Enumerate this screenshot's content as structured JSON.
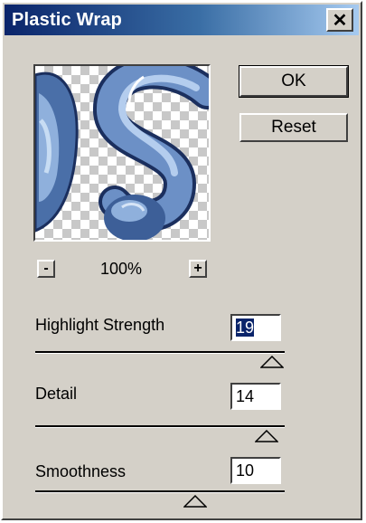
{
  "dialog": {
    "title": "Plastic Wrap",
    "close_glyph": "✕"
  },
  "buttons": {
    "ok_label": "OK",
    "reset_label": "Reset"
  },
  "zoom": {
    "minus_label": "-",
    "level": "100%",
    "plus_label": "+"
  },
  "controls": [
    {
      "label": "Highlight Strength",
      "value": "19",
      "min": 0,
      "max": 20,
      "selected": true
    },
    {
      "label": "Detail",
      "value": "14",
      "min": 1,
      "max": 15
    },
    {
      "label": "Smoothness",
      "value": "10",
      "min": 1,
      "max": 15
    }
  ],
  "colors": {
    "dialog_face": "#d4d0c8",
    "title_gradient_start": "#0a246a",
    "title_gradient_end": "#a6caf0",
    "selection": "#0a246a"
  },
  "icons": {
    "close": "close-icon",
    "zoom_out": "minus-icon",
    "zoom_in": "plus-icon",
    "slider_thumb": "triangle-up-icon"
  }
}
